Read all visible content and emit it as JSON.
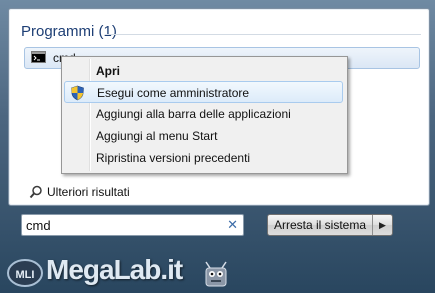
{
  "results": {
    "group_header": "Programmi (1)",
    "item_label": "cmd",
    "more_results": "Ulteriori risultati"
  },
  "context_menu": {
    "items": [
      {
        "label": "Apri",
        "bold": true
      },
      {
        "label": "Esegui come amministratore",
        "icon": "shield-icon",
        "highlighted": true
      },
      {
        "label": "Aggiungi alla barra delle applicazioni"
      },
      {
        "label": "Aggiungi al menu Start"
      },
      {
        "label": "Ripristina versioni precedenti"
      }
    ]
  },
  "search": {
    "value": "cmd",
    "clear_glyph": "✕"
  },
  "shutdown": {
    "label": "Arresta il sistema",
    "arrow": "▶"
  },
  "watermark": {
    "logo_text": "MLI",
    "site_name": "MegaLab.it"
  }
}
